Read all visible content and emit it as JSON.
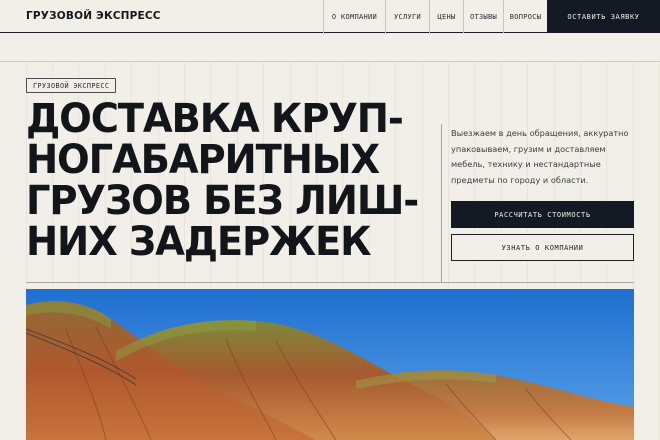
{
  "header": {
    "logo": "ГРУЗОВОЙ ЭКСПРЕСС",
    "nav": [
      "О КОМПАНИИ",
      "УСЛУГИ",
      "ЦЕНЫ",
      "ОТЗЫВЫ",
      "ВОПРОСЫ"
    ],
    "cta": "ОСТАВИТЬ ЗАЯВКУ"
  },
  "hero": {
    "tag": "ГРУЗОВОЙ ЭКСПРЕСС",
    "title_lines": [
      "ДОСТАВКА КРУП-",
      "НОГАБАРИТНЫХ",
      "ГРУЗОВ БЕЗ ЛИШ-",
      "НИХ ЗАДЕРЖЕК"
    ],
    "description": "Выезжаем в день обращения, аккуратно упаковываем, грузим и доставляем мебель, технику и нестандартные предметы по городу и области.",
    "primary_button": "РАССЧИТАТЬ СТОИМОСТЬ",
    "secondary_button": "УЗНАТЬ О КОМПАНИИ"
  },
  "colors": {
    "background": "#f2efe9",
    "dark": "#141a23",
    "sky": "#2f7fd8",
    "hills": "#b4502a"
  }
}
